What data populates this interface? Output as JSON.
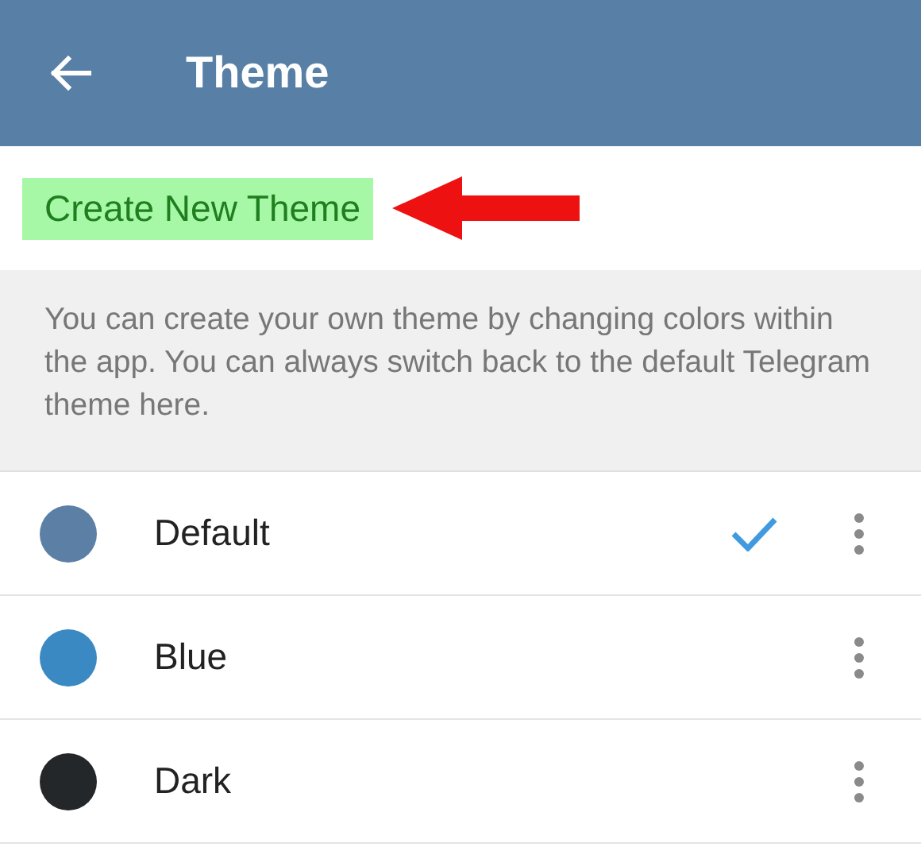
{
  "header": {
    "title": "Theme"
  },
  "create_theme": {
    "label": "Create New Theme",
    "highlighted": true
  },
  "info_text": "You can create your own theme by changing colors within the app. You can always switch back to the default Telegram theme here.",
  "themes": [
    {
      "name": "Default",
      "color": "#5b7fa5",
      "selected": true
    },
    {
      "name": "Blue",
      "color": "#3a89c3",
      "selected": false
    },
    {
      "name": "Dark",
      "color": "#24272a",
      "selected": false
    }
  ]
}
